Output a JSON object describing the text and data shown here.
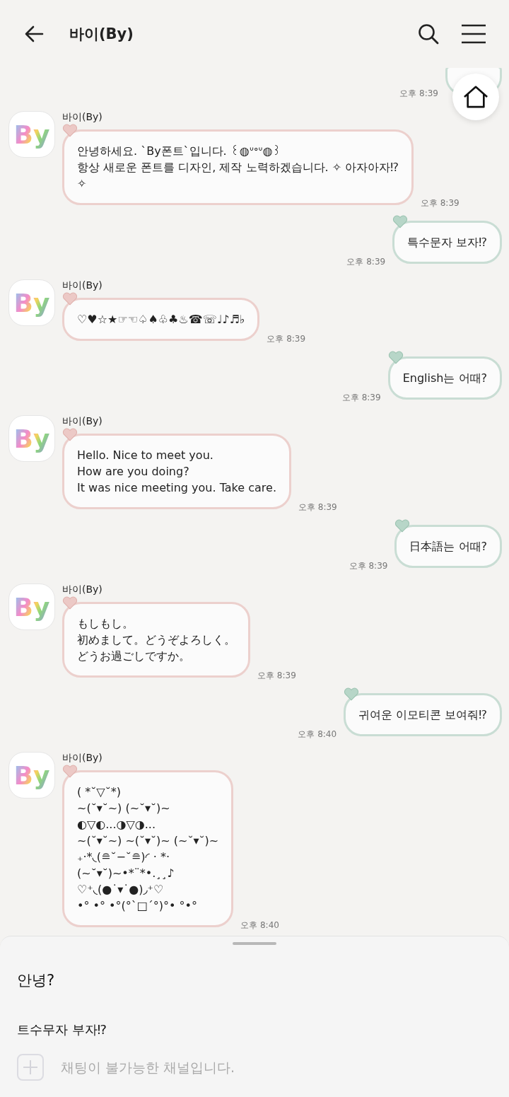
{
  "header": {
    "title": "바이(By)"
  },
  "messages": [
    {
      "kind": "clipped",
      "time": "오후 8:39"
    },
    {
      "kind": "in",
      "sender": "바이(By)",
      "avatar": "By",
      "lines": [
        "안녕하세요. `By폰트`입니다. ꒰◍ᐡᐤᐡ◍꒱",
        "항상 새로운 폰트를 디자인, 제작 노력하겠습니다. ✧ 아자아자⁉",
        "✧"
      ],
      "time": "오후 8:39"
    },
    {
      "kind": "out",
      "lines": [
        "특수문자 보자⁉"
      ],
      "time": "오후 8:39"
    },
    {
      "kind": "in",
      "sender": "바이(By)",
      "avatar": "By",
      "lines": [
        "♡♥☆★☞☜♤♠♧♣♨☎☏♩♪♬♭"
      ],
      "time": "오후 8:39"
    },
    {
      "kind": "out",
      "lines": [
        "English는 어때?"
      ],
      "time": "오후 8:39"
    },
    {
      "kind": "in",
      "sender": "바이(By)",
      "avatar": "By",
      "lines": [
        "Hello. Nice to meet you.",
        "How are you doing?",
        "It was nice meeting you. Take care."
      ],
      "time": "오후 8:39"
    },
    {
      "kind": "out",
      "lines": [
        "日本語는 어때?"
      ],
      "time": "오후 8:39"
    },
    {
      "kind": "in",
      "sender": "바이(By)",
      "avatar": "By",
      "lines": [
        "もしもし。",
        "初めまして。どうぞよろしく。",
        "どうお過ごしですか。"
      ],
      "time": "오후 8:39"
    },
    {
      "kind": "out",
      "lines": [
        "귀여운 이모티콘 보여줘⁉"
      ],
      "time": "오후 8:40"
    },
    {
      "kind": "in",
      "sender": "바이(By)",
      "avatar": "By",
      "lines": [
        "( *˘▽˘*)",
        "~(˘▾˘~) (~˘▾˘)~",
        "◐▽◐...◑▽◑...",
        "~(˘▾˘~) ~(˘▾˘)~ (~˘▾˘)~",
        "₊·*◟(≘˘−˘≘)◜ · *·",
        "(~˘▾˘)~•*¨*•.¸¸♪",
        "♡⁺◟(●˙▾˙●)◞⁺♡",
        "•° •° •°(°`□´°)°• °•°"
      ],
      "time": "오후 8:40"
    }
  ],
  "quick_replies": [
    "안녕?",
    "트수무자 부자⁉"
  ],
  "input": {
    "placeholder": "채팅이 불가능한 채널입니다.",
    "disabled": true
  }
}
